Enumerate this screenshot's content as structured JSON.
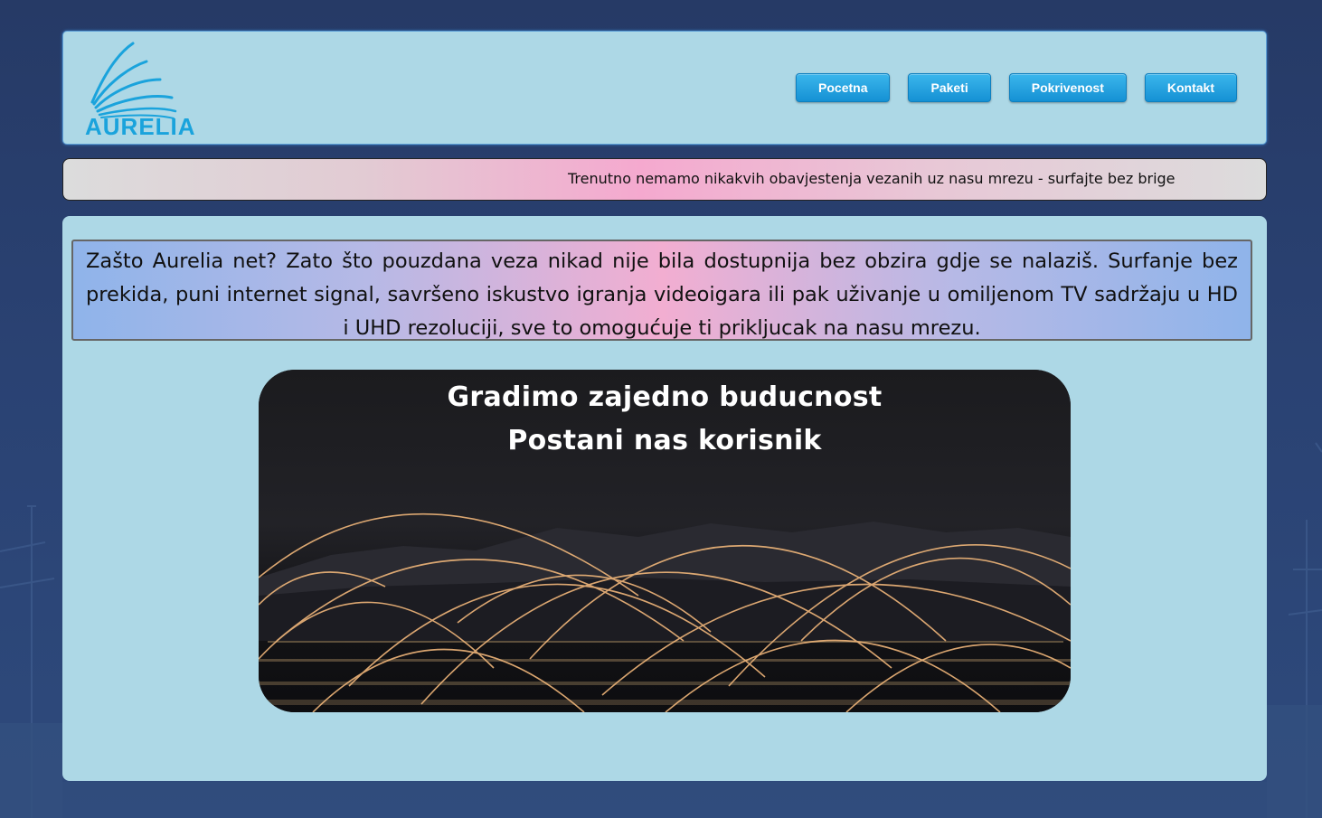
{
  "brand": {
    "name": "AURELIA"
  },
  "nav": {
    "items": [
      {
        "label": "Pocetna"
      },
      {
        "label": "Paketi"
      },
      {
        "label": "Pokrivenost"
      },
      {
        "label": "Kontakt"
      }
    ]
  },
  "notice": {
    "text": "Trenutno nemamo nikakvih obavjestenja vezanih uz nasu mrezu - surfajte bez brige"
  },
  "main": {
    "intro": "Zašto Aurelia net? Zato što pouzdana veza nikad nije bila dostupnija bez obzira gdje se nalaziš. Surfanje bez prekida, puni internet signal, savršeno iskustvo igranja videoigara ili pak uživanje u omiljenom TV sadržaju u HD i UHD rezoluciji, sve to omogućuje ti prikljucak na nasu mrezu.",
    "hero": {
      "line1": "Gradimo zajedno buducnost",
      "line2": "Postani nas korisnik"
    }
  },
  "colors": {
    "accent": "#1aa3dc",
    "panel": "#add8e6",
    "page_background": "#2a4273"
  },
  "icons": {
    "logo": "aurelia-wave-logo-icon"
  }
}
